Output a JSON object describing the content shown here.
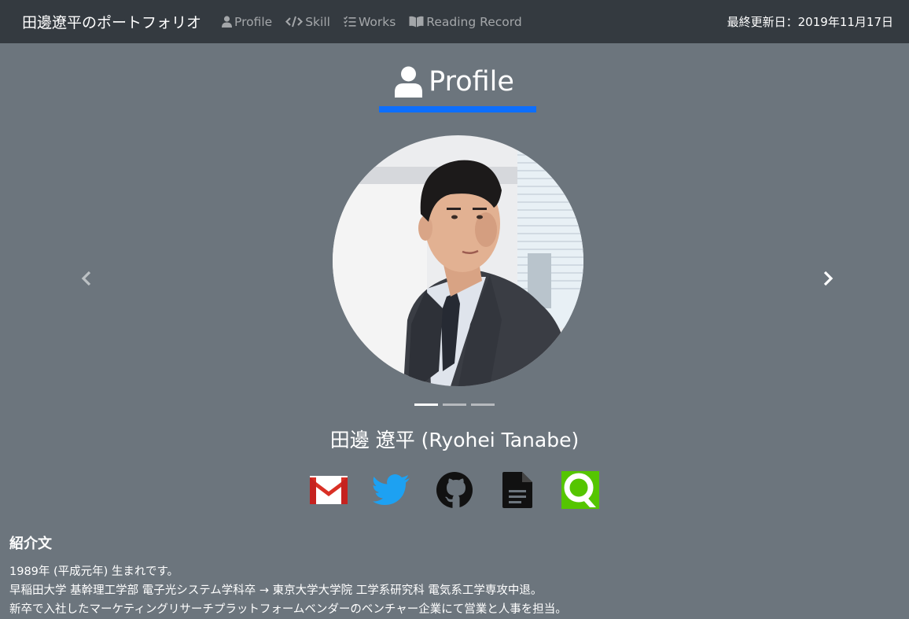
{
  "navbar": {
    "brand": "田邊遼平のポートフォリオ",
    "links": [
      {
        "label": "Profile",
        "icon": "user-icon"
      },
      {
        "label": "Skill",
        "icon": "code-icon"
      },
      {
        "label": "Works",
        "icon": "tasks-icon"
      },
      {
        "label": "Reading Record",
        "icon": "book-open-icon"
      }
    ],
    "last_updated": "最終更新日：2019年11月17日"
  },
  "section": {
    "title": "Profile",
    "icon": "user-icon",
    "underline_color": "#0d6efd"
  },
  "carousel": {
    "slide_count": 3,
    "active_slide": 1,
    "prev_icon": "chevron-left-icon",
    "next_icon": "chevron-right-icon"
  },
  "profile": {
    "name": "田邊 遼平 (Ryohei Tanabe)"
  },
  "socials": [
    {
      "name": "gmail",
      "icon": "gmail-icon"
    },
    {
      "name": "twitter",
      "icon": "twitter-icon"
    },
    {
      "name": "github",
      "icon": "github-icon"
    },
    {
      "name": "resume",
      "icon": "document-icon"
    },
    {
      "name": "qiita",
      "icon": "qiita-icon"
    }
  ],
  "intro": {
    "heading": "紹介文",
    "lines": [
      "1989年 (平成元年) 生まれです。",
      "早稲田大学 基幹理工学部 電子光システム学科卒 → 東京大学大学院 工学系研究科 電気系工学専攻中退。",
      "新卒で入社したマーケティングリサーチプラットフォームベンダーのベンチャー企業にて営業と人事を担当。"
    ]
  },
  "colors": {
    "navbar_bg": "#343a40",
    "page_bg": "#6c757d",
    "accent": "#0d6efd"
  }
}
